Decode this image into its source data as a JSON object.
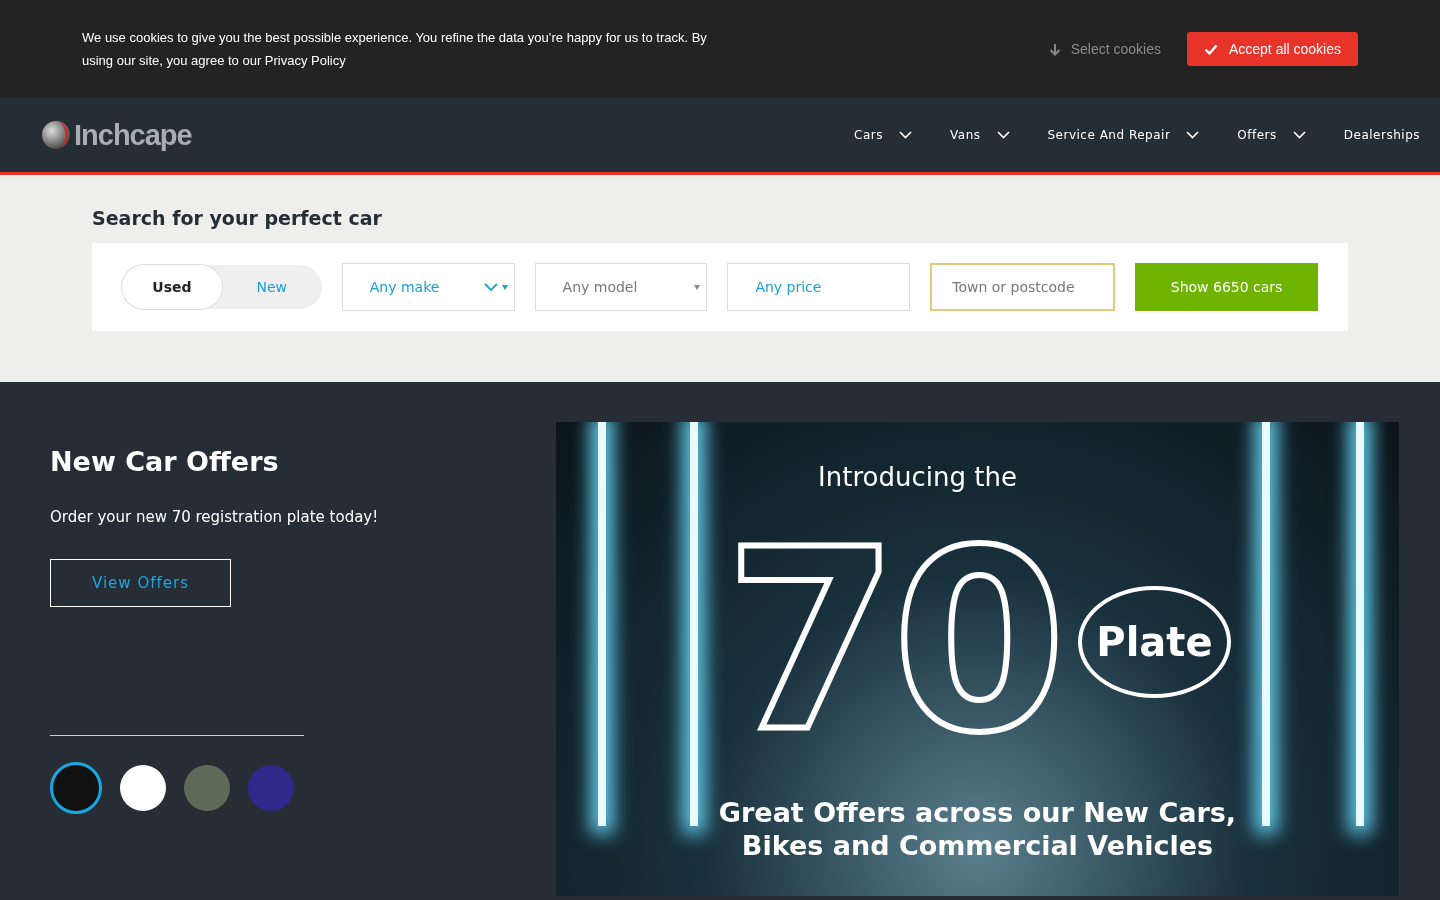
{
  "cookie_bar": {
    "message": "We use cookies to give you the best possible experience. You refine the data you’re happy for us to track. By using our site, you agree to our Privacy Policy",
    "select_label": "Select cookies",
    "accept_label": "Accept all cookies"
  },
  "header": {
    "logo": "Inchcape",
    "nav": [
      {
        "label": "Cars",
        "dropdown": true
      },
      {
        "label": "Vans",
        "dropdown": true
      },
      {
        "label": "Service And Repair",
        "dropdown": true
      },
      {
        "label": "Offers",
        "dropdown": true
      },
      {
        "label": "Dealerships",
        "dropdown": false
      }
    ]
  },
  "search": {
    "title": "Search for your perfect car",
    "condition": [
      {
        "label": "Used",
        "selected": true
      },
      {
        "label": "New",
        "selected": false
      }
    ],
    "fields": [
      {
        "kind": "select",
        "value": "Any make",
        "active": true
      },
      {
        "kind": "select",
        "value": "Any model",
        "active": false
      },
      {
        "kind": "select",
        "value": "Any price",
        "active": true
      },
      {
        "kind": "input",
        "placeholder": "Town or postcode",
        "focused": true
      }
    ],
    "submit": "Show 6650 cars"
  },
  "promo": {
    "title": "New Car Offers",
    "text": "Order your new 70 registration plate today!",
    "button": "View Offers",
    "thumbnails": [
      {
        "selected": true
      },
      {
        "selected": false
      },
      {
        "selected": false
      },
      {
        "selected": false
      }
    ],
    "banner": {
      "intro": "Introducing the",
      "number": "70",
      "plate": "Plate",
      "tagline": "Great Offers across our New Cars, Bikes and Commercial Vehicles"
    }
  }
}
